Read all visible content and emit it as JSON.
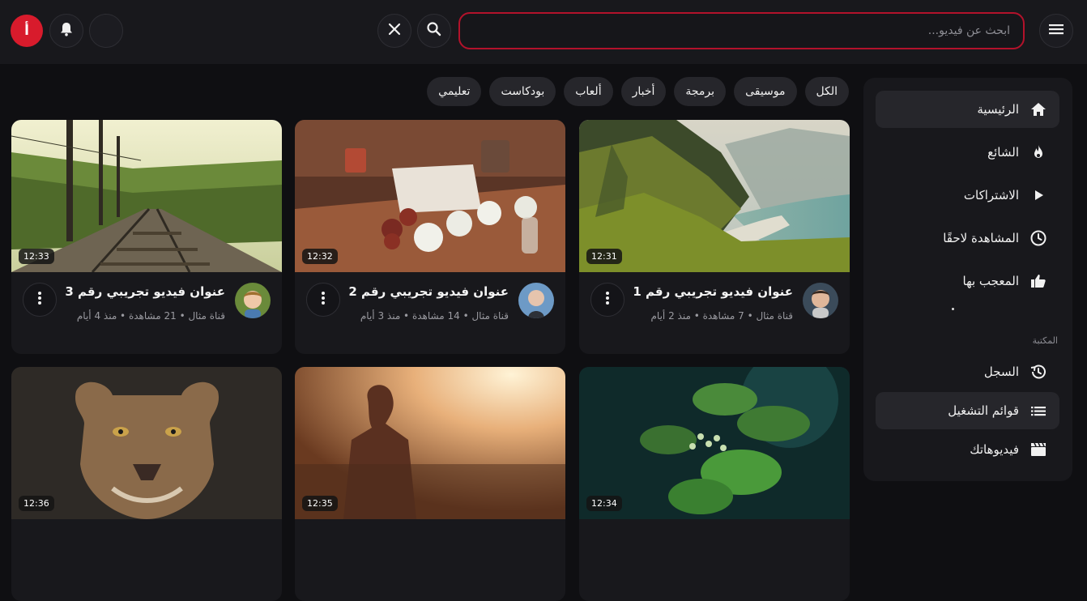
{
  "header": {
    "menu_icon": "hamburger-icon",
    "search_placeholder": "ابحث عن فيديو...",
    "search_value": "",
    "search_icon": "search-icon",
    "clear_icon": "close-icon",
    "theme_icon": "moon-icon",
    "bell_icon": "bell-icon",
    "avatar_letter": "أ",
    "accent_color": "#d81b2c"
  },
  "sidebar": {
    "items": [
      {
        "label": "الرئيسية",
        "icon": "home-icon",
        "active": true
      },
      {
        "label": "الشائع",
        "icon": "flame-icon",
        "active": false
      },
      {
        "label": "الاشتراكات",
        "icon": "play-icon",
        "active": false
      },
      {
        "label": "المشاهدة لاحقًا",
        "icon": "clock-icon",
        "active": false
      },
      {
        "label": "المعجب بها",
        "icon": "thumbs-up-icon",
        "active": false
      }
    ],
    "section_label": "المكتبة",
    "library": [
      {
        "label": "السجل",
        "icon": "history-icon",
        "active": false
      },
      {
        "label": "قوائم التشغيل",
        "icon": "playlist-icon",
        "active": true
      },
      {
        "label": "فيديوهاتك",
        "icon": "clapperboard-icon",
        "active": false
      }
    ]
  },
  "chips": [
    "الكل",
    "موسيقى",
    "برمجة",
    "أخبار",
    "ألعاب",
    "بودكاست",
    "تعليمي"
  ],
  "videos": [
    {
      "title": "عنوان فيديو تجريبي رقم 1",
      "meta": "قناة مثال • 7 مشاهدة • منذ 2 أيام",
      "duration": "12:31",
      "thumb": "coastal-cliffs",
      "avatar": "child-avatar"
    },
    {
      "title": "عنوان فيديو تجريبي رقم 2",
      "meta": "قناة مثال • 14 مشاهدة • منذ 3 أيام",
      "duration": "12:32",
      "thumb": "cups-on-table",
      "avatar": "man-avatar"
    },
    {
      "title": "عنوان فيديو تجريبي رقم 3",
      "meta": "قناة مثال • 21 مشاهدة • منذ 4 أيام",
      "duration": "12:33",
      "thumb": "railway-tracks",
      "avatar": "boy-avatar"
    },
    {
      "title": "",
      "meta": "",
      "duration": "12:34",
      "thumb": "green-plant",
      "avatar": ""
    },
    {
      "title": "",
      "meta": "",
      "duration": "12:35",
      "thumb": "woman-sunset",
      "avatar": ""
    },
    {
      "title": "",
      "meta": "",
      "duration": "12:36",
      "thumb": "lioness",
      "avatar": ""
    }
  ]
}
